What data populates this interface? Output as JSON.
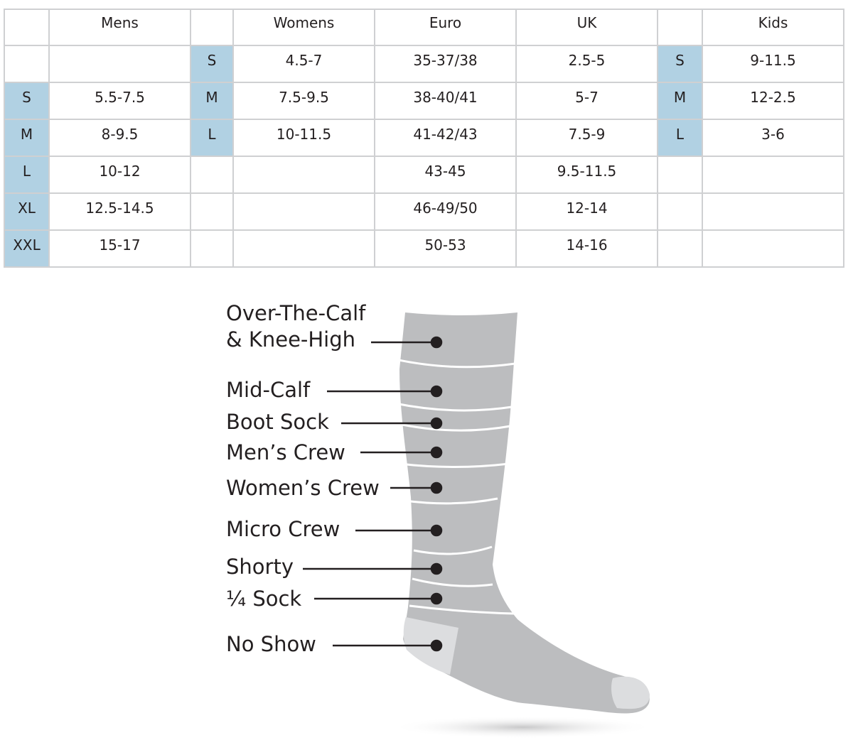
{
  "table": {
    "headers": [
      "",
      "Mens",
      "",
      "Womens",
      "Euro",
      "UK",
      "",
      "Kids"
    ],
    "rows": [
      [
        "",
        "",
        "S",
        "4.5-7",
        "35-37/38",
        "2.5-5",
        "S",
        "9-11.5"
      ],
      [
        "S",
        "5.5-7.5",
        "M",
        "7.5-9.5",
        "38-40/41",
        "5-7",
        "M",
        "12-2.5"
      ],
      [
        "M",
        "8-9.5",
        "L",
        "10-11.5",
        "41-42/43",
        "7.5-9",
        "L",
        "3-6"
      ],
      [
        "L",
        "10-12",
        "",
        "",
        "43-45",
        "9.5-11.5",
        "",
        ""
      ],
      [
        "XL",
        "12.5-14.5",
        "",
        "",
        "46-49/50",
        "12-14",
        "",
        ""
      ],
      [
        "XXL",
        "15-17",
        "",
        "",
        "50-53",
        "14-16",
        "",
        ""
      ]
    ]
  },
  "sock_heights": [
    {
      "line1": "Over-The-Calf",
      "line2": "& Knee-High"
    },
    {
      "line1": "Mid-Calf"
    },
    {
      "line1": "Boot Sock"
    },
    {
      "line1": "Men’s Crew"
    },
    {
      "line1": "Women’s Crew"
    },
    {
      "line1": "Micro Crew"
    },
    {
      "line1": "Shorty"
    },
    {
      "line1": "¼ Sock"
    },
    {
      "line1": "No Show"
    }
  ],
  "colors": {
    "size_label_bg": "#b1d1e3",
    "grid_line": "#cfd0d2",
    "sock_gray": "#bcbdbf",
    "sock_light": "#dcdddf"
  }
}
